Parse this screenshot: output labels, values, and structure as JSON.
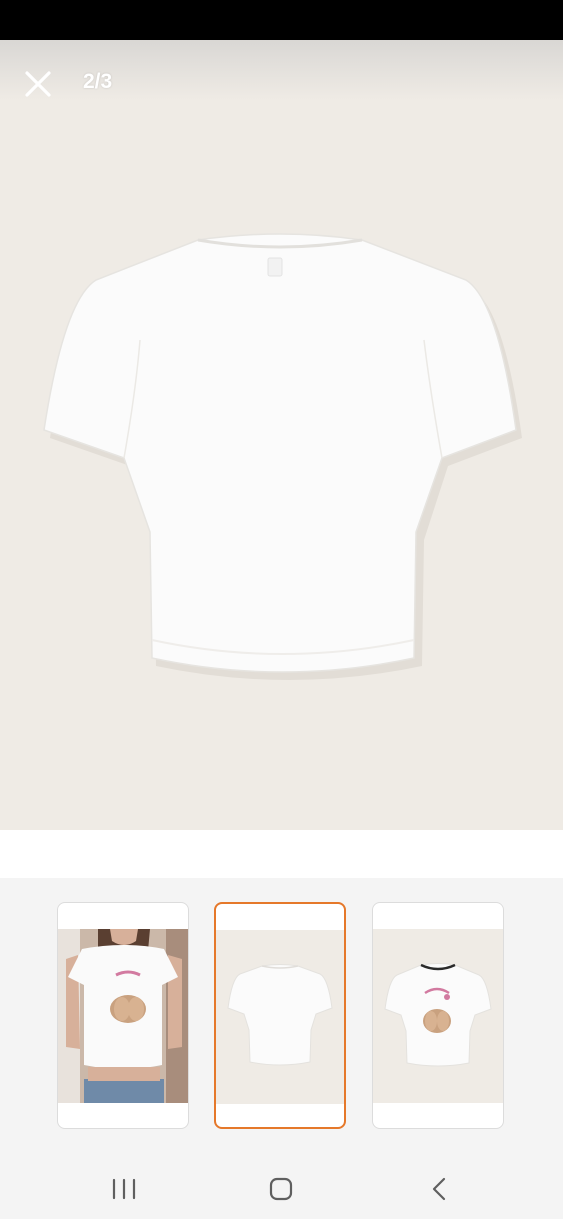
{
  "viewer": {
    "counter": "2/3",
    "close_icon": "close-icon",
    "background_color": "#efebe5",
    "accent_color": "#e5782a"
  },
  "thumbnails": [
    {
      "name": "model-front-photo",
      "selected": false
    },
    {
      "name": "tshirt-back-photo",
      "selected": true
    },
    {
      "name": "tshirt-front-photo",
      "selected": false
    }
  ],
  "navigation": {
    "recent_icon": "recent-apps-icon",
    "home_icon": "home-icon",
    "back_icon": "back-icon"
  }
}
